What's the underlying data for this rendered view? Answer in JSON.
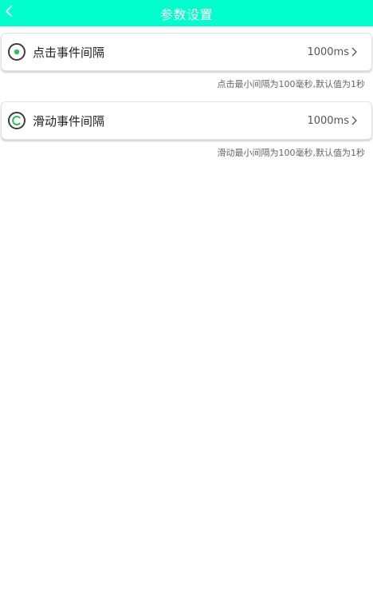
{
  "header": {
    "title": "参数设置",
    "back_icon": "chevron-left-icon",
    "background_color": "#00ffcc"
  },
  "settings": [
    {
      "label": "点击事件间隔",
      "value": "1000ms",
      "icon": "radio-dot-icon",
      "hint": "点击最小间隔为100毫秒,默认值为1秒"
    },
    {
      "label": "滑动事件间隔",
      "value": "1000ms",
      "icon": "swipe-c-icon",
      "hint": "滑动最小间隔为100毫秒,默认值为1秒"
    }
  ],
  "colors": {
    "accent_green": "#2ebf59",
    "icon_ring": "#3d3d3d"
  }
}
